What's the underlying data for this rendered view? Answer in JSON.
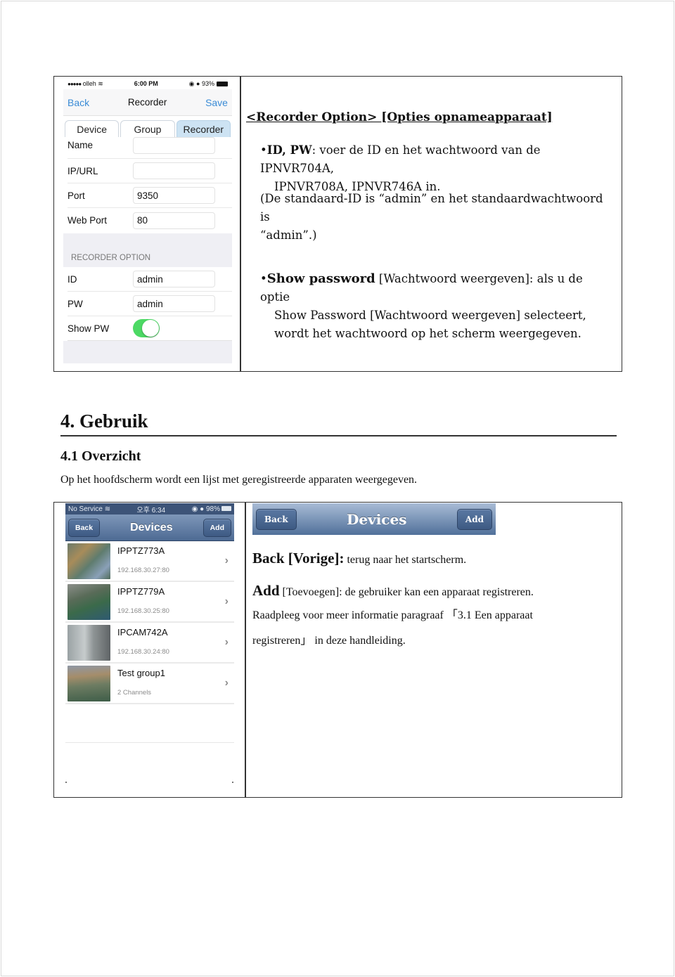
{
  "recorder_screen": {
    "status_bar": {
      "carrier": "olleh",
      "time": "6:00 PM",
      "battery": "93%"
    },
    "nav": {
      "back": "Back",
      "title": "Recorder",
      "save": "Save"
    },
    "tabs": [
      {
        "label": "Device",
        "active": false
      },
      {
        "label": "Group",
        "active": false
      },
      {
        "label": "Recorder",
        "active": true
      }
    ],
    "fields": [
      {
        "label": "Name",
        "value": ""
      },
      {
        "label": "IP/URL",
        "value": ""
      },
      {
        "label": "Port",
        "value": "9350"
      },
      {
        "label": "Web Port",
        "value": "80"
      }
    ],
    "section_title": "RECORDER OPTION",
    "option_fields": [
      {
        "label": "ID",
        "value": "admin"
      },
      {
        "label": "PW",
        "value": "admin"
      }
    ],
    "show_pw": {
      "label": "Show PW",
      "enabled": true
    },
    "colors": {
      "accent": "#3a8bd6",
      "tab_active": "#cde3f3",
      "toggle_on": "#4cd964"
    }
  },
  "recorder_text": {
    "heading": "<Recorder Option> [Opties opnameapparaat]",
    "id_pw": {
      "bold": "ID, PW",
      "line1": ": voer de ID en het wachtwoord van de IPNVR704A,",
      "line2": "IPNVR708A, IPNVR746A in."
    },
    "note_line1": "(De standaard-ID is “admin” en het standaardwachtwoord is",
    "note_line2": "“admin”.)",
    "show_password": {
      "bold": "Show password",
      "line1": " [Wachtwoord weergeven]: als u de optie",
      "line2": "Show Password [Wachtwoord weergeven] selecteert,",
      "line3": "wordt het wachtwoord op het scherm weergegeven."
    }
  },
  "section": {
    "title": "4. Gebruik",
    "subtitle": "4.1 Overzicht",
    "intro": "Op het hoofdscherm wordt een lijst met geregistreerde apparaten weergegeven."
  },
  "devices_screen": {
    "status_bar": {
      "carrier": "No Service",
      "time": "오후 6:34",
      "battery": "98%"
    },
    "nav": {
      "back": "Back",
      "title": "Devices",
      "add": "Add"
    },
    "devices": [
      {
        "name": "IPPTZ773A",
        "sub": "192.168.30.27:80"
      },
      {
        "name": "IPPTZ779A",
        "sub": "192.168.30.25:80"
      },
      {
        "name": "IPCAM742A",
        "sub": "192.168.30.24:80"
      },
      {
        "name": "Test group1",
        "sub": "2 Channels"
      }
    ]
  },
  "devices_bar": {
    "back": "Back",
    "title": "Devices",
    "add": "Add"
  },
  "devices_text": {
    "back_bold": "Back [Vorige]:",
    "back_desc": " terug naar het startscherm.",
    "add_bold": "Add",
    "add_desc": " [Toevoegen]: de gebruiker kan een apparaat registreren.",
    "ref_line1": "Raadpleeg voor meer informatie paragraaf 「3.1 Een apparaat",
    "ref_line2": "registreren」 in deze handleiding."
  }
}
